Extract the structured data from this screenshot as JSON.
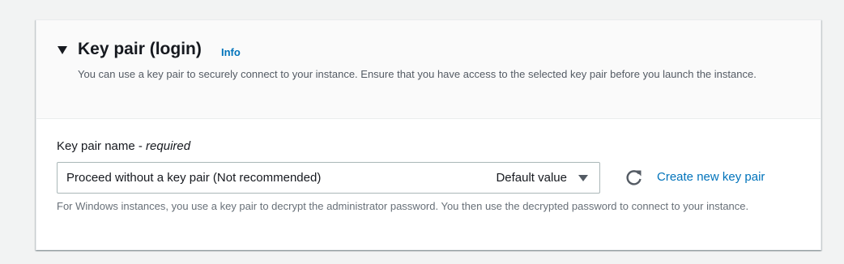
{
  "section": {
    "title": "Key pair (login)",
    "info_label": "Info",
    "description": "You can use a key pair to securely connect to your instance. Ensure that you have access to the selected key pair before you launch the instance."
  },
  "key_pair_field": {
    "label": "Key pair name - ",
    "required_label": "required",
    "selected_value": "Proceed without a key pair (Not recommended)",
    "selected_tag": "Default value",
    "create_link": "Create new key pair",
    "hint": "For Windows instances, you use a key pair to decrypt the administrator password. You then use the decrypted password to connect to your instance."
  },
  "icons": {
    "collapse": "caret-down-icon",
    "dropdown": "dropdown-caret-icon",
    "refresh": "refresh-icon"
  },
  "colors": {
    "link": "#0073bb",
    "text": "#16191f",
    "secondary_text": "#545b64",
    "header_bg": "#fafafa"
  }
}
